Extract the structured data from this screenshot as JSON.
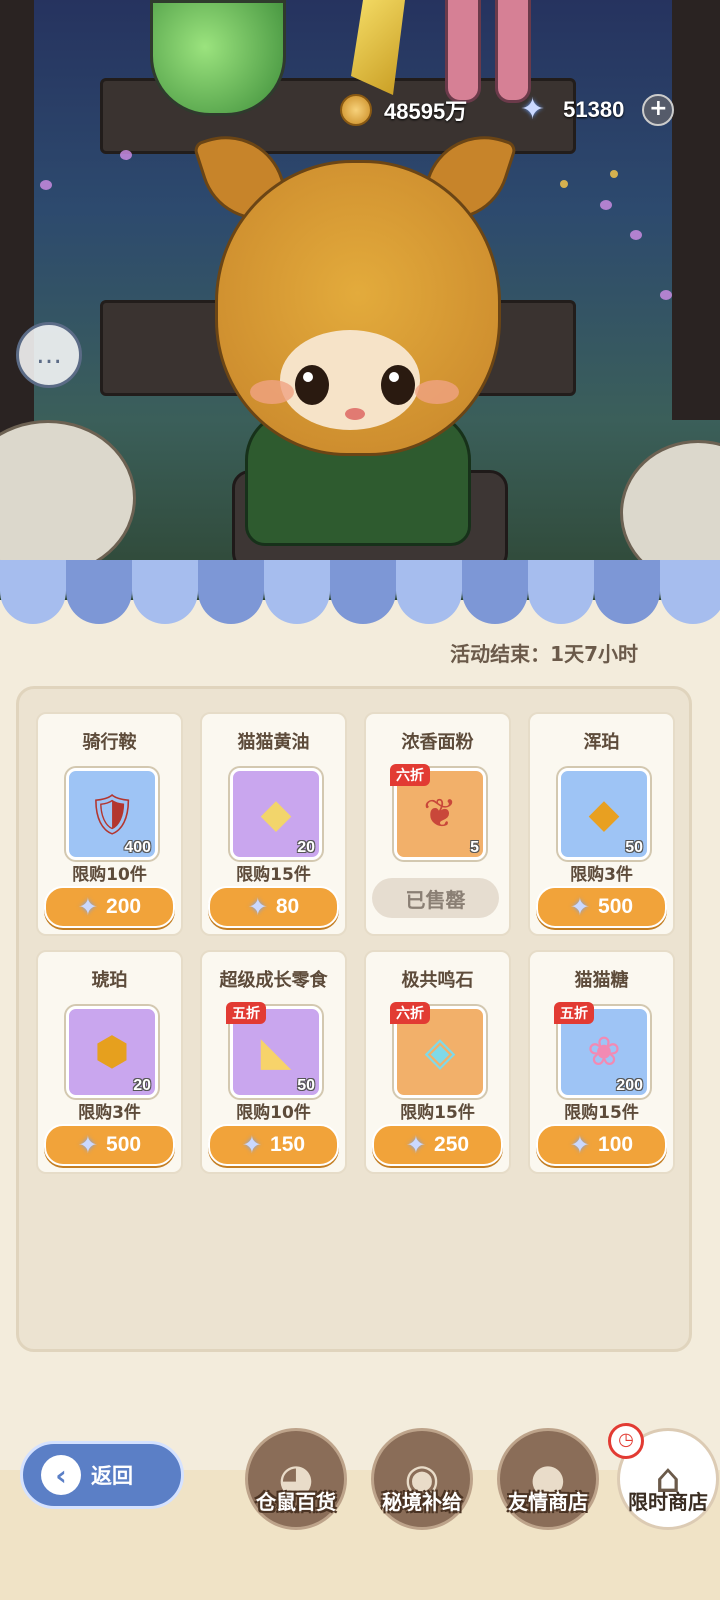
{
  "currency": {
    "coins": "48595万",
    "stars": "51380"
  },
  "shop": {
    "timer": "活动结束：1天7小时",
    "items": [
      {
        "name": "骑行鞍",
        "qty": "400",
        "limit": "限购10件",
        "price": "200",
        "discount": "",
        "rarity": "blue",
        "icon": "saddle-icon",
        "sold_out": false
      },
      {
        "name": "猫猫黄油",
        "qty": "20",
        "limit": "限购15件",
        "price": "80",
        "discount": "",
        "rarity": "purple",
        "icon": "butter-icon",
        "sold_out": false
      },
      {
        "name": "浓香面粉",
        "qty": "5",
        "limit": "",
        "price": "",
        "discount": "六折",
        "rarity": "orange",
        "icon": "flour-bag-icon",
        "sold_out": true,
        "sold_out_label": "已售罄"
      },
      {
        "name": "浑珀",
        "qty": "50",
        "limit": "限购3件",
        "price": "500",
        "discount": "",
        "rarity": "blue",
        "icon": "amber-crystal-icon",
        "sold_out": false
      },
      {
        "name": "琥珀",
        "qty": "20",
        "limit": "限购3件",
        "price": "500",
        "discount": "",
        "rarity": "purple",
        "icon": "amber-gem-icon",
        "sold_out": false
      },
      {
        "name": "超级成长零食",
        "qty": "50",
        "limit": "限购10件",
        "price": "150",
        "discount": "五折",
        "rarity": "purple",
        "icon": "cheese-icon",
        "sold_out": false
      },
      {
        "name": "极共鸣石",
        "qty": "",
        "limit": "限购15件",
        "price": "250",
        "discount": "六折",
        "rarity": "orange",
        "icon": "resonance-stone-icon",
        "sold_out": false
      },
      {
        "name": "猫猫糖",
        "qty": "200",
        "limit": "限购15件",
        "price": "100",
        "discount": "五折",
        "rarity": "blue",
        "icon": "paw-candy-icon",
        "sold_out": false
      }
    ]
  },
  "nav": {
    "back_label": "返回",
    "items": [
      {
        "label": "仓鼠百货",
        "icon": "hamster-icon",
        "active": false
      },
      {
        "label": "秘境补给",
        "icon": "eye-emblem-icon",
        "active": false
      },
      {
        "label": "友情商店",
        "icon": "crystal-ball-icon",
        "active": false
      },
      {
        "label": "限时商店",
        "icon": "shop-stall-icon",
        "active": true
      }
    ]
  },
  "colors": {
    "awning_blue": "#8fa9e3",
    "price_orange": "#f1a33a",
    "discount_red": "#e23b33",
    "panel_bg": "#ece3d1"
  }
}
